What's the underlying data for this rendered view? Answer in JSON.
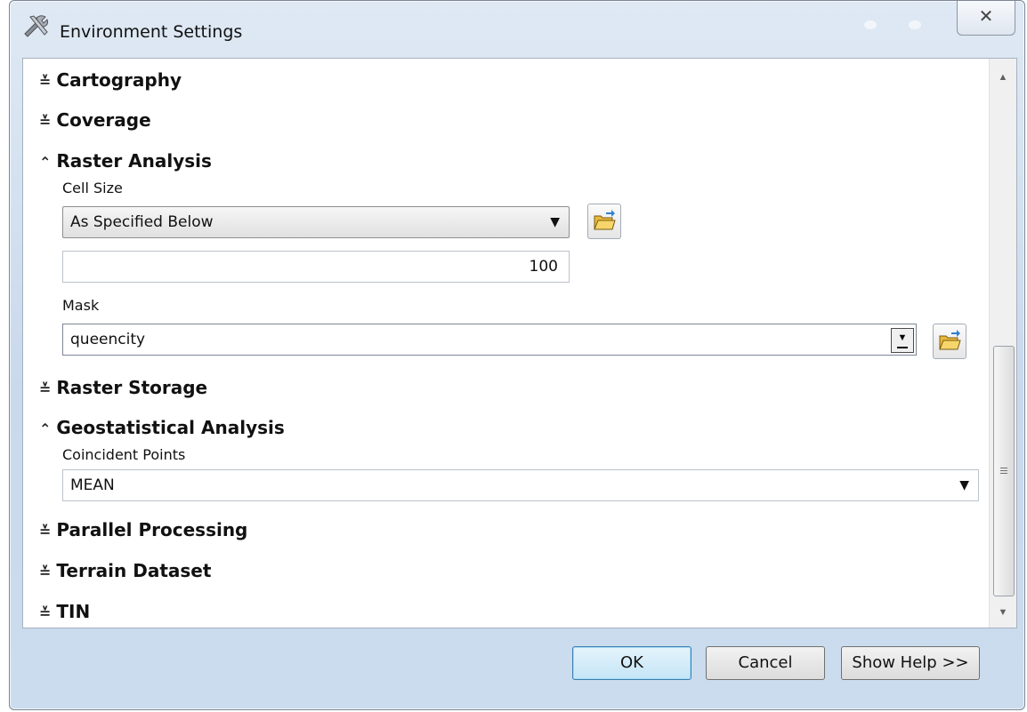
{
  "window": {
    "title": "Environment Settings",
    "close_symbol": "✕"
  },
  "sections": [
    {
      "label": "Cartography",
      "state": "collapsed"
    },
    {
      "label": "Coverage",
      "state": "collapsed"
    },
    {
      "label": "Raster Analysis",
      "state": "expanded"
    },
    {
      "label": "Raster Storage",
      "state": "collapsed"
    },
    {
      "label": "Geostatistical Analysis",
      "state": "expanded"
    },
    {
      "label": "Parallel Processing",
      "state": "collapsed"
    },
    {
      "label": "Terrain Dataset",
      "state": "collapsed"
    },
    {
      "label": "TIN",
      "state": "collapsed"
    }
  ],
  "chevrons": {
    "collapsed": "≚",
    "expanded": "⌃"
  },
  "raster_analysis": {
    "cell_size_label": "Cell Size",
    "cell_size_option": "As Specified Below",
    "cell_size_value": "100",
    "mask_label": "Mask",
    "mask_value": "queencity"
  },
  "geostatistical": {
    "coincident_label": "Coincident Points",
    "coincident_value": "MEAN"
  },
  "buttons": {
    "ok": "OK",
    "cancel": "Cancel",
    "help": "Show Help >>"
  },
  "icons": {
    "title": "tools-icon",
    "folder": "open-folder-icon"
  },
  "colors": {
    "window_frame": "#c8d9ec",
    "primary_button": "#c4e5f6",
    "folder": "#f2c94c"
  }
}
